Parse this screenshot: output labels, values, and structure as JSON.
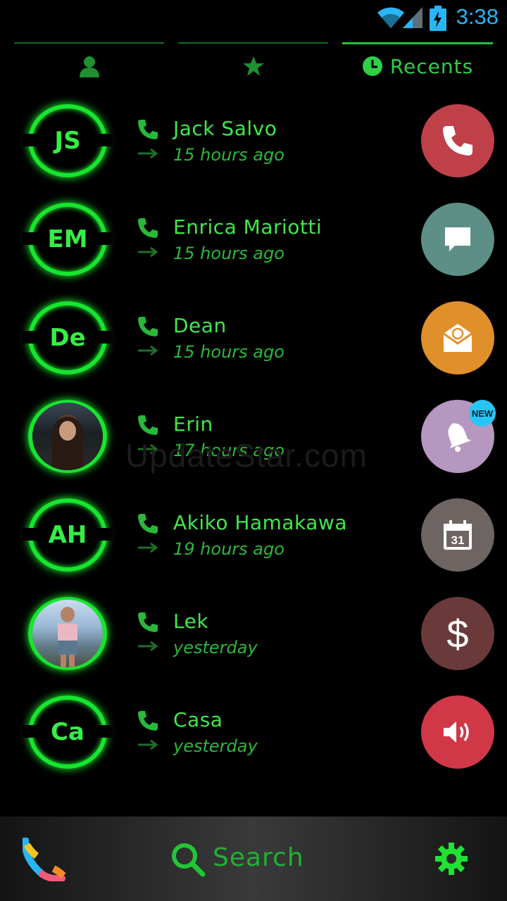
{
  "status_bar": {
    "time": "3:38"
  },
  "tabs": [
    {
      "icon": "person-icon",
      "label": ""
    },
    {
      "icon": "star-icon",
      "label": ""
    },
    {
      "icon": "clock-icon",
      "label": "Recents"
    }
  ],
  "contacts": [
    {
      "initials": "JS",
      "name": "Jack Salvo",
      "time": "15 hours ago"
    },
    {
      "initials": "EM",
      "name": "Enrica Mariotti",
      "time": "15 hours ago"
    },
    {
      "initials": "De",
      "name": "Dean",
      "time": "15 hours ago"
    },
    {
      "initials": "",
      "name": "Erin",
      "time": "17 hours ago"
    },
    {
      "initials": "AH",
      "name": "Akiko Hamakawa",
      "time": "19 hours ago"
    },
    {
      "initials": "",
      "name": "Lek",
      "time": "yesterday"
    },
    {
      "initials": "Ca",
      "name": "Casa",
      "time": "yesterday"
    }
  ],
  "side_actions": [
    {
      "icon": "phone-icon",
      "color": "#c0404a"
    },
    {
      "icon": "message-icon",
      "color": "#5e8f86"
    },
    {
      "icon": "email-icon",
      "color": "#e0902a"
    },
    {
      "icon": "bell-icon",
      "color": "#b597bf",
      "badge": "NEW"
    },
    {
      "icon": "calendar-icon",
      "color": "#6e6562",
      "calendar_day": "31"
    },
    {
      "icon": "dollar-icon",
      "color": "#6a3a3a",
      "symbol": "$"
    },
    {
      "icon": "volume-icon",
      "color": "#d03848"
    }
  ],
  "watermark": "UpdateStar.com",
  "bottom_bar": {
    "search_label": "Search"
  },
  "colors": {
    "accent_green": "#3ee94a",
    "status_blue": "#29b6f6"
  }
}
